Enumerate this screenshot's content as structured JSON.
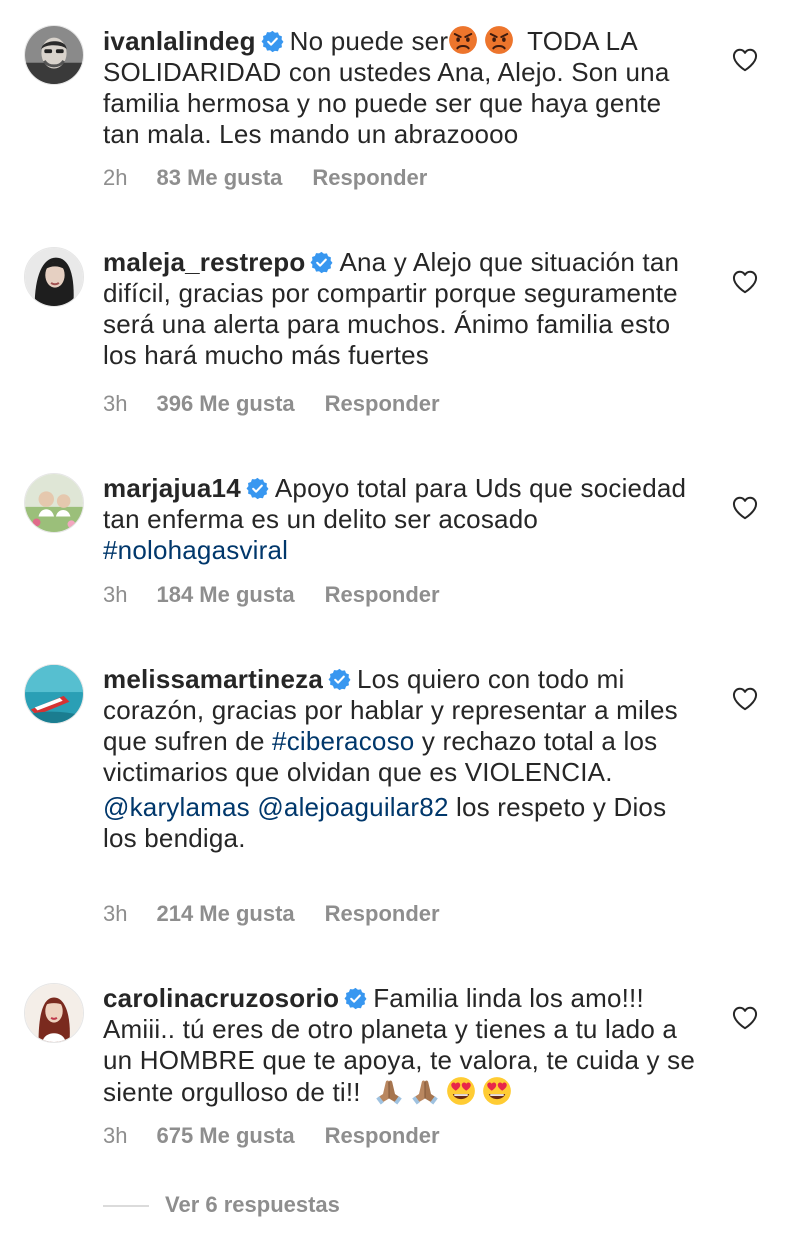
{
  "comments": [
    {
      "username": "ivanlalindeg",
      "verified": true,
      "emoji": [
        "angry-face",
        "angry-face"
      ],
      "text_before_emoji": "No puede ser",
      "text_after_emoji": " TODA LA SOLIDARIDAD con ustedes Ana, Alejo. Son una familia hermosa y no puede ser que haya gente tan mala. Les mando un abrazoooo",
      "time": "2h",
      "likes": "83 Me gusta",
      "reply": "Responder"
    },
    {
      "username": "maleja_restrepo",
      "verified": true,
      "text": "Ana y Alejo que situación tan difícil, gracias por compartir porque seguramente será una alerta para muchos. Ánimo familia esto los hará mucho más fuertes",
      "time": "3h",
      "likes": "396 Me gusta",
      "reply": "Responder"
    },
    {
      "username": "marjajua14",
      "verified": true,
      "text": "Apoyo total para Uds que sociedad tan enferma es un delito ser acosado",
      "hashtag": "#nolohagasviral",
      "time": "3h",
      "likes": "184 Me gusta",
      "reply": "Responder"
    },
    {
      "username": "melissamartineza",
      "verified": true,
      "text_a": "Los quiero con todo mi corazón, gracias por hablar y representar a miles que sufren de",
      "hashtag": "#ciberacoso",
      "text_b": "y rechazo total a los victimarios que olvidan que es VIOLENCIA.",
      "mention_1": "@karylamas",
      "mention_2": "@alejoaguilar82",
      "text_c": "los respeto y Dios los bendiga.",
      "time": "3h",
      "likes": "214 Me gusta",
      "reply": "Responder"
    },
    {
      "username": "carolinacruzosorio",
      "verified": true,
      "text": "Familia linda los amo!!! Amiii.. tú eres de otro planeta y tienes a tu lado a un HOMBRE que te apoya, te valora, te cuida y se siente orgulloso de ti!!",
      "emoji": [
        "folded-hands",
        "folded-hands",
        "heart-eyes",
        "heart-eyes"
      ],
      "time": "3h",
      "likes": "675 Me gusta",
      "reply": "Responder"
    }
  ],
  "view_replies": "Ver 6 respuestas",
  "colors": {
    "text": "#262626",
    "secondary": "#8e8e8e",
    "link": "#00376b",
    "verified": "#3897f0"
  }
}
